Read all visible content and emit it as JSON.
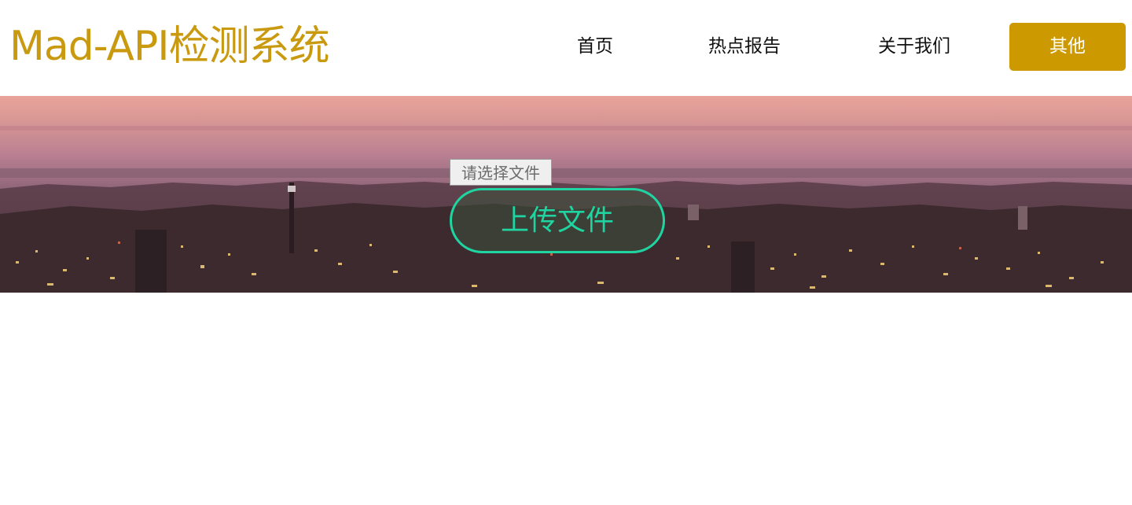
{
  "header": {
    "brand_title": "Mad-API检测系统",
    "nav": {
      "home_label": "首页",
      "hot_reports_label": "热点报告",
      "about_label": "关于我们",
      "other_label": "其他"
    }
  },
  "hero": {
    "file_picker_label": "请选择文件",
    "upload_button_label": "上传文件"
  },
  "colors": {
    "brand": "#c99a10",
    "accent_button": "#cc9900",
    "upload_accent": "#1fd4a0"
  }
}
